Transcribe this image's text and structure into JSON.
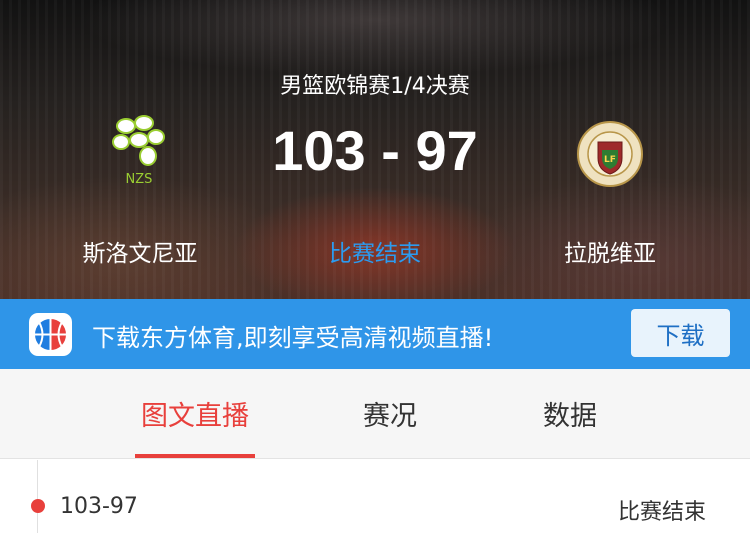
{
  "match": {
    "competition": "男篮欧锦赛1/4决赛",
    "score": "103 - 97",
    "status": "比赛结束",
    "home_team": {
      "name": "斯洛文尼亚",
      "logo_text": "NZS",
      "logo_icon": "nzs-logo-icon"
    },
    "away_team": {
      "name": "拉脱维亚",
      "logo_icon": "latvia-federation-logo-icon"
    }
  },
  "banner": {
    "text": "下载东方体育,即刻享受高清视频直播!",
    "button_label": "下载",
    "app_icon": "basketball-app-icon"
  },
  "tabs": [
    {
      "label": "图文直播",
      "active": true
    },
    {
      "label": "赛况",
      "active": false
    },
    {
      "label": "数据",
      "active": false
    }
  ],
  "feed": [
    {
      "score": "103-97",
      "status": "比赛结束"
    }
  ],
  "colors": {
    "accent_red": "#e8403c",
    "status_blue": "#2b9bf0",
    "banner_blue": "#2f95e8"
  }
}
